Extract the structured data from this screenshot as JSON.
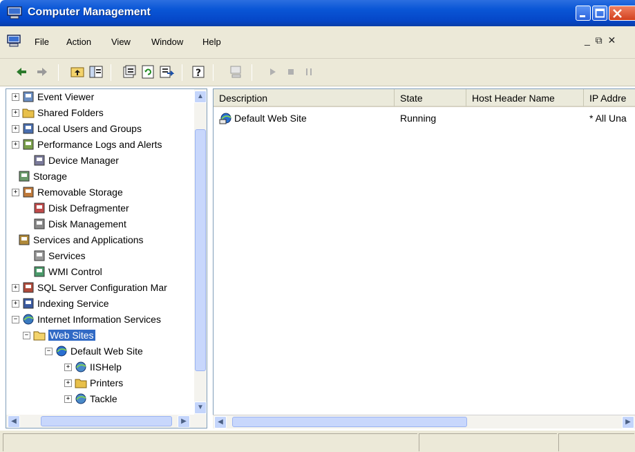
{
  "window": {
    "title": "Computer Management",
    "controls": {
      "minimize_icon": "minimize-icon",
      "maximize_icon": "maximize-icon",
      "close_icon": "close-icon"
    }
  },
  "menu": {
    "items": [
      {
        "label": "File"
      },
      {
        "label": "Action"
      },
      {
        "label": "View"
      },
      {
        "label": "Window"
      },
      {
        "label": "Help"
      }
    ],
    "mdi_controls": "_ ⧉ ✕"
  },
  "toolbar": {
    "buttons": [
      "back-arrow-icon",
      "forward-arrow-icon",
      "up-folder-icon",
      "show-hide-tree-icon",
      "properties-icon",
      "refresh-icon",
      "export-list-icon",
      "help-icon",
      "computer-icon",
      "start-icon",
      "stop-icon",
      "pause-icon"
    ]
  },
  "tree": {
    "items": [
      {
        "label": "Event Viewer",
        "expander": "+",
        "icon": "event-viewer-icon"
      },
      {
        "label": "Shared Folders",
        "expander": "+",
        "icon": "shared-folders-icon"
      },
      {
        "label": "Local Users and Groups",
        "expander": "+",
        "icon": "users-icon"
      },
      {
        "label": "Performance Logs and Alerts",
        "expander": "+",
        "icon": "performance-icon"
      },
      {
        "label": "Device Manager",
        "expander": "",
        "icon": "device-manager-icon"
      },
      {
        "label": "Storage",
        "expander": "",
        "icon": "storage-icon"
      },
      {
        "label": "Removable Storage",
        "expander": "+",
        "icon": "removable-storage-icon"
      },
      {
        "label": "Disk Defragmenter",
        "expander": "",
        "icon": "defrag-icon"
      },
      {
        "label": "Disk Management",
        "expander": "",
        "icon": "disk-management-icon"
      },
      {
        "label": "Services and Applications",
        "expander": "",
        "icon": "services-apps-icon"
      },
      {
        "label": "Services",
        "expander": "",
        "icon": "services-icon"
      },
      {
        "label": "WMI Control",
        "expander": "",
        "icon": "wmi-icon"
      },
      {
        "label": "SQL Server Configuration Mar",
        "expander": "+",
        "icon": "sql-server-icon"
      },
      {
        "label": "Indexing Service",
        "expander": "+",
        "icon": "indexing-icon"
      },
      {
        "label": "Internet Information Services",
        "expander": "−",
        "icon": "iis-icon"
      },
      {
        "label": "Web Sites",
        "expander": "−",
        "icon": "folder-icon"
      },
      {
        "label": "Default Web Site",
        "expander": "−",
        "icon": "web-site-icon"
      },
      {
        "label": "IISHelp",
        "expander": "+",
        "icon": "web-folder-icon"
      },
      {
        "label": "Printers",
        "expander": "+",
        "icon": "printers-folder-icon"
      },
      {
        "label": "Tackle",
        "expander": "+",
        "icon": "web-folder-icon"
      }
    ]
  },
  "details": {
    "columns": [
      {
        "label": "Description"
      },
      {
        "label": "State"
      },
      {
        "label": "Host Header Name"
      },
      {
        "label": "IP Addre"
      }
    ],
    "rows": [
      {
        "description": "Default Web Site",
        "state": "Running",
        "host_header": "",
        "ip": "* All Una"
      }
    ]
  },
  "colors": {
    "titlebar": "#0a56d6",
    "chrome": "#ece9d8",
    "selection": "#316ac5"
  }
}
